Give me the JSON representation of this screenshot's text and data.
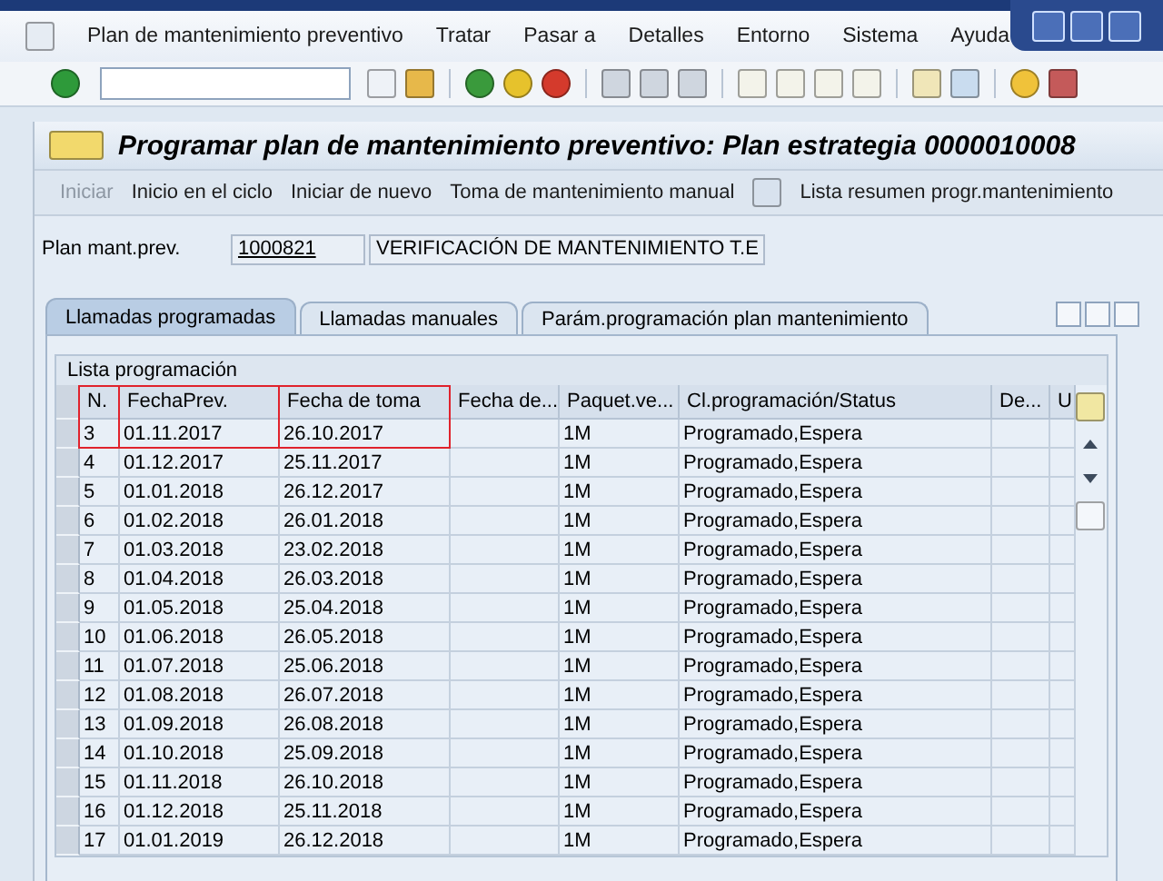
{
  "menu_bar": {
    "items": [
      "Plan de mantenimiento preventivo",
      "Tratar",
      "Pasar a",
      "Detalles",
      "Entorno",
      "Sistema",
      "Ayuda"
    ]
  },
  "screen_title": "Programar plan de mantenimiento preventivo: Plan estrategia 0000010008",
  "app_toolbar": [
    {
      "label": "Iniciar",
      "disabled": true
    },
    {
      "label": "Inicio en el ciclo",
      "disabled": false
    },
    {
      "label": "Iniciar de nuevo",
      "disabled": false
    },
    {
      "label": "Toma de mantenimiento manual",
      "disabled": false
    },
    {
      "label": "Lista resumen progr.mantenimiento",
      "disabled": false
    }
  ],
  "plan_field": {
    "label": "Plan mant.prev.",
    "value": "1000821",
    "description": "VERIFICACIÓN DE MANTENIMIENTO T.E"
  },
  "tabs": [
    {
      "label": "Llamadas programadas",
      "selected": true
    },
    {
      "label": "Llamadas manuales",
      "selected": false
    },
    {
      "label": "Parám.programación plan mantenimiento",
      "selected": false
    }
  ],
  "table": {
    "title": "Lista programación",
    "columns": [
      {
        "label": "N.",
        "framed": true
      },
      {
        "label": "FechaPrev.",
        "framed": true
      },
      {
        "label": "Fecha de toma",
        "framed": true
      },
      {
        "label": "Fecha de...",
        "framed": false
      },
      {
        "label": "Paquet.ve...",
        "framed": false
      },
      {
        "label": "Cl.programación/Status",
        "framed": false
      },
      {
        "label": "De...",
        "framed": false
      },
      {
        "label": "U",
        "framed": false
      }
    ],
    "rows": [
      [
        "3",
        "01.11.2017",
        "26.10.2017",
        "",
        "1M",
        "Programado,Espera",
        "",
        ""
      ],
      [
        "4",
        "01.12.2017",
        "25.11.2017",
        "",
        "1M",
        "Programado,Espera",
        "",
        ""
      ],
      [
        "5",
        "01.01.2018",
        "26.12.2017",
        "",
        "1M",
        "Programado,Espera",
        "",
        ""
      ],
      [
        "6",
        "01.02.2018",
        "26.01.2018",
        "",
        "1M",
        "Programado,Espera",
        "",
        ""
      ],
      [
        "7",
        "01.03.2018",
        "23.02.2018",
        "",
        "1M",
        "Programado,Espera",
        "",
        ""
      ],
      [
        "8",
        "01.04.2018",
        "26.03.2018",
        "",
        "1M",
        "Programado,Espera",
        "",
        ""
      ],
      [
        "9",
        "01.05.2018",
        "25.04.2018",
        "",
        "1M",
        "Programado,Espera",
        "",
        ""
      ],
      [
        "10",
        "01.06.2018",
        "26.05.2018",
        "",
        "1M",
        "Programado,Espera",
        "",
        ""
      ],
      [
        "11",
        "01.07.2018",
        "25.06.2018",
        "",
        "1M",
        "Programado,Espera",
        "",
        ""
      ],
      [
        "12",
        "01.08.2018",
        "26.07.2018",
        "",
        "1M",
        "Programado,Espera",
        "",
        ""
      ],
      [
        "13",
        "01.09.2018",
        "26.08.2018",
        "",
        "1M",
        "Programado,Espera",
        "",
        ""
      ],
      [
        "14",
        "01.10.2018",
        "25.09.2018",
        "",
        "1M",
        "Programado,Espera",
        "",
        ""
      ],
      [
        "15",
        "01.11.2018",
        "26.10.2018",
        "",
        "1M",
        "Programado,Espera",
        "",
        ""
      ],
      [
        "16",
        "01.12.2018",
        "25.11.2018",
        "",
        "1M",
        "Programado,Espera",
        "",
        ""
      ],
      [
        "17",
        "01.01.2019",
        "26.12.2018",
        "",
        "1M",
        "Programado,Espera",
        "",
        ""
      ]
    ]
  }
}
